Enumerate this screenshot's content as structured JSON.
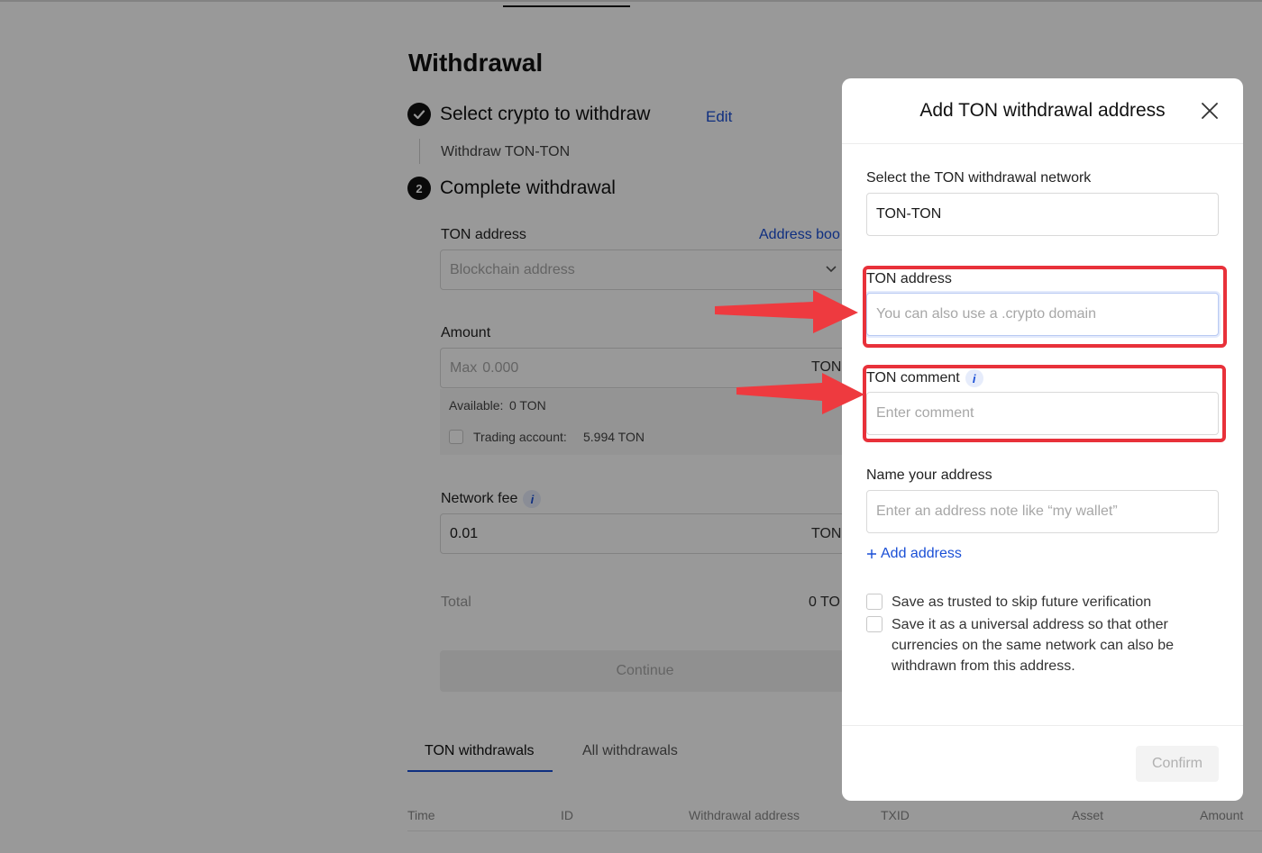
{
  "page": {
    "title": "Withdrawal",
    "step1": {
      "number": "✓",
      "label": "Select crypto to withdraw",
      "edit": "Edit",
      "sub": "Withdraw TON-TON"
    },
    "step2": {
      "number": "2",
      "label": "Complete withdrawal"
    },
    "address": {
      "label": "TON address",
      "book": "Address boo",
      "placeholder": "Blockchain address"
    },
    "amount": {
      "label": "Amount",
      "prefix": "Max",
      "placeholder": "0.000",
      "suffix": "TON",
      "available_label": "Available:",
      "available_value": "0 TON",
      "trading_label": "Trading account:",
      "trading_value": "5.994 TON"
    },
    "fee": {
      "label": "Network fee",
      "value": "0.01",
      "suffix": "TON"
    },
    "total": {
      "label": "Total",
      "value": "0 TO"
    },
    "continue": "Continue",
    "tabs": [
      "TON withdrawals",
      "All withdrawals"
    ],
    "columns": [
      "Time",
      "ID",
      "Withdrawal address",
      "TXID",
      "Asset",
      "Amount"
    ]
  },
  "modal": {
    "title": "Add TON withdrawal address",
    "network_label": "Select the TON withdrawal network",
    "network_value": "TON-TON",
    "address_label": "TON address",
    "address_placeholder": "You can also use a .crypto domain",
    "comment_label": "TON comment",
    "comment_placeholder": "Enter comment",
    "name_label": "Name your address",
    "name_placeholder": "Enter an address note like “my wallet”",
    "add_address": "Add address",
    "check1": "Save as trusted to skip future verification",
    "check2": "Save it as a universal address so that other currencies on the same network can also be withdrawn from this address.",
    "confirm": "Confirm"
  },
  "colors": {
    "accent": "#1a4fd6",
    "annotation": "#e8313a"
  },
  "icons": {
    "close": "close-icon",
    "info": "info-icon",
    "chevron": "chevron-down-icon",
    "check": "check-circle-icon",
    "plus": "plus-icon"
  }
}
